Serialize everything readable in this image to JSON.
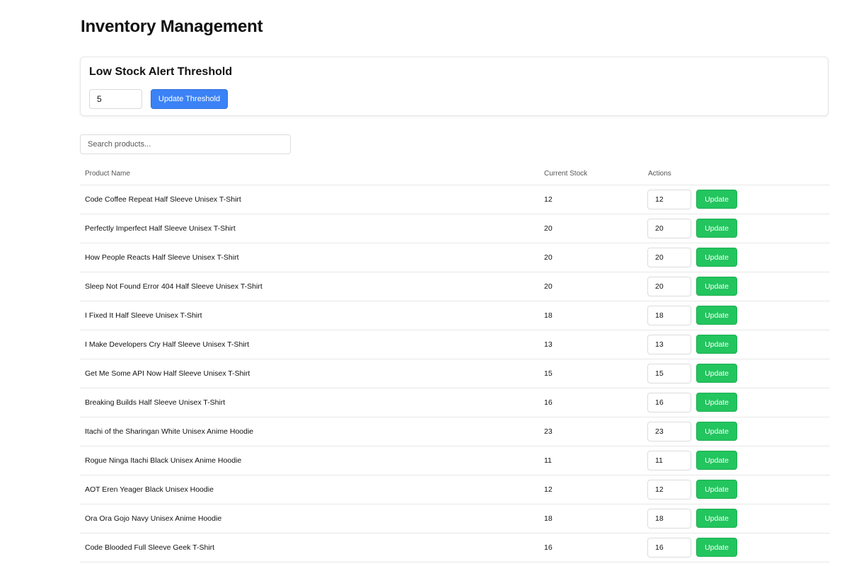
{
  "page": {
    "title": "Inventory Management"
  },
  "threshold": {
    "title": "Low Stock Alert Threshold",
    "value": "5",
    "button_label": "Update Threshold"
  },
  "search": {
    "placeholder": "Search products...",
    "value": ""
  },
  "table": {
    "columns": [
      "Product Name",
      "Current Stock",
      "Actions"
    ],
    "update_label": "Update",
    "rows": [
      {
        "name": "Code Coffee Repeat Half Sleeve Unisex T-Shirt",
        "stock": "12",
        "input": "12"
      },
      {
        "name": "Perfectly Imperfect Half Sleeve Unisex T-Shirt",
        "stock": "20",
        "input": "20"
      },
      {
        "name": "How People Reacts Half Sleeve Unisex T-Shirt",
        "stock": "20",
        "input": "20"
      },
      {
        "name": "Sleep Not Found Error 404 Half Sleeve Unisex T-Shirt",
        "stock": "20",
        "input": "20"
      },
      {
        "name": "I Fixed It Half Sleeve Unisex T-Shirt",
        "stock": "18",
        "input": "18"
      },
      {
        "name": "I Make Developers Cry Half Sleeve Unisex T-Shirt",
        "stock": "13",
        "input": "13"
      },
      {
        "name": "Get Me Some API Now Half Sleeve Unisex T-Shirt",
        "stock": "15",
        "input": "15"
      },
      {
        "name": "Breaking Builds Half Sleeve Unisex T-Shirt",
        "stock": "16",
        "input": "16"
      },
      {
        "name": "Itachi of the Sharingan White Unisex Anime Hoodie",
        "stock": "23",
        "input": "23"
      },
      {
        "name": "Rogue Ninga Itachi Black Unisex Anime Hoodie",
        "stock": "11",
        "input": "11"
      },
      {
        "name": "AOT Eren Yeager Black Unisex Hoodie",
        "stock": "12",
        "input": "12"
      },
      {
        "name": "Ora Ora Gojo Navy Unisex Anime Hoodie",
        "stock": "18",
        "input": "18"
      },
      {
        "name": "Code Blooded Full Sleeve Geek T-Shirt",
        "stock": "16",
        "input": "16"
      }
    ]
  },
  "colors": {
    "primary_button": "#3b82f6",
    "update_button": "#22c55e",
    "border": "#e8e8e8"
  }
}
